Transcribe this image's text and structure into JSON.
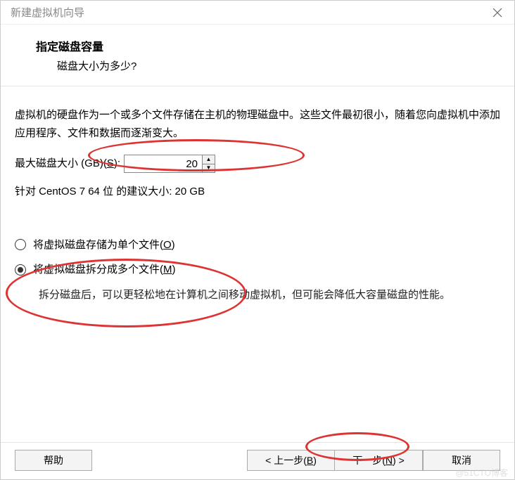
{
  "window": {
    "title": "新建虚拟机向导"
  },
  "header": {
    "title": "指定磁盘容量",
    "subtitle": "磁盘大小为多少?"
  },
  "body": {
    "description": "虚拟机的硬盘作为一个或多个文件存储在主机的物理磁盘中。这些文件最初很小，随着您向虚拟机中添加应用程序、文件和数据而逐渐变大。",
    "size_label_pre": "最大磁盘大小 (GB)(",
    "size_label_hotkey": "S",
    "size_label_post": "):",
    "size_value": "20",
    "recommend": "针对 CentOS 7 64 位 的建议大小: 20 GB",
    "radio_single_pre": "将虚拟磁盘存储为单个文件(",
    "radio_single_hotkey": "O",
    "radio_single_post": ")",
    "radio_split_pre": "将虚拟磁盘拆分成多个文件(",
    "radio_split_hotkey": "M",
    "radio_split_post": ")",
    "radio_split_desc": "拆分磁盘后，可以更轻松地在计算机之间移动虚拟机，但可能会降低大容量磁盘的性能。"
  },
  "footer": {
    "help": "帮助",
    "back_pre": "< 上一步(",
    "back_hotkey": "B",
    "back_post": ")",
    "next_pre": "下一步(",
    "next_hotkey": "N",
    "next_post": ") >",
    "cancel": "取消"
  },
  "watermark": "@51CTO博客"
}
